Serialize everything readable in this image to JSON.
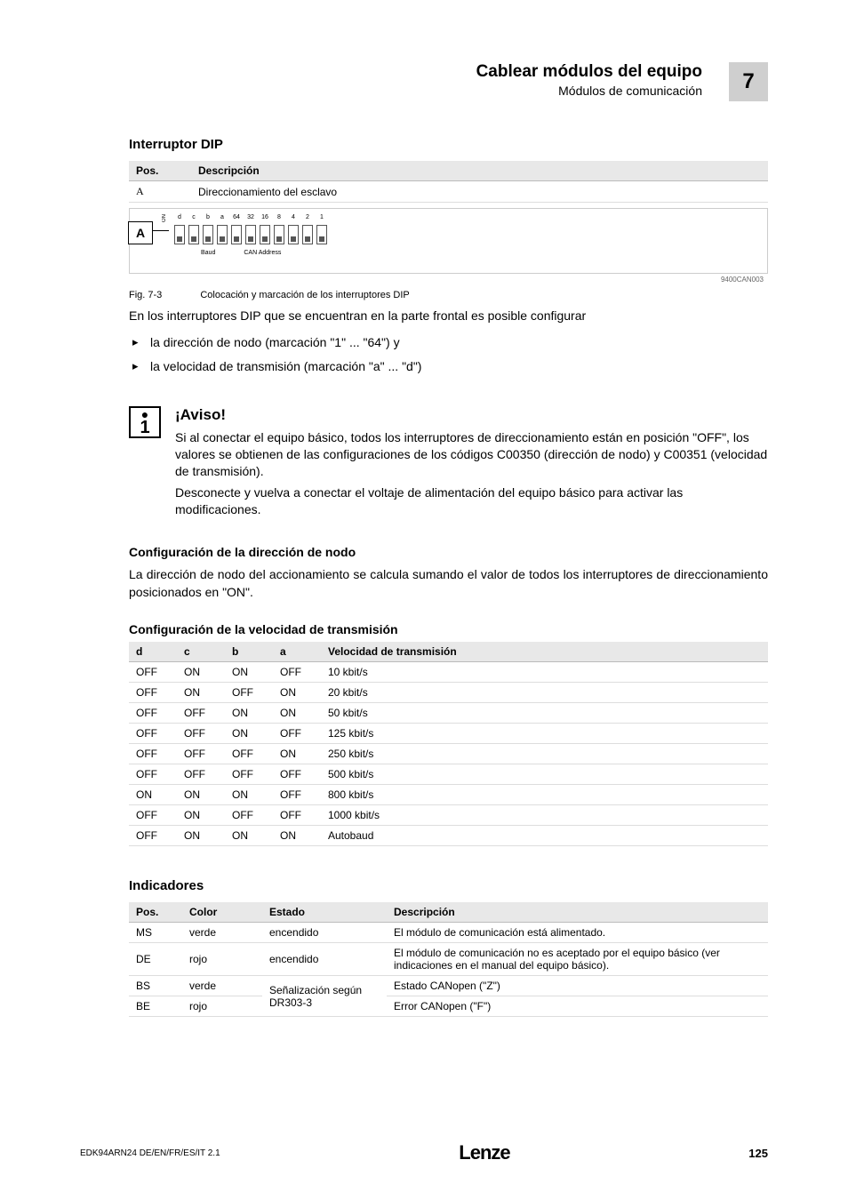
{
  "header": {
    "title": "Cablear módulos del equipo",
    "subtitle": "Módulos de comunicación",
    "section_number": "7"
  },
  "dip_section_title": "Interruptor DIP",
  "pos_table": {
    "head_pos": "Pos.",
    "head_desc": "Descripción",
    "pos_a": "A",
    "desc_a": "Direccionamiento del esclavo"
  },
  "dip_diagram": {
    "letter": "A",
    "on": "ON",
    "labels": [
      "d",
      "c",
      "b",
      "a",
      "64",
      "32",
      "16",
      "8",
      "4",
      "2",
      "1"
    ],
    "baud_label": "Baud",
    "addr_label": "CAN Address",
    "code": "9400CAN003"
  },
  "fig": {
    "no": "Fig. 7-3",
    "text": "Colocación y marcación de los interruptores DIP"
  },
  "intro_text": "En los interruptores DIP que se encuentran en la parte frontal es posible configurar",
  "bullets": {
    "b1": "la dirección de nodo (marcación \"1\" ... \"64\") y",
    "b2": "la velocidad de transmisión (marcación \"a\" ... \"d\")"
  },
  "aviso": {
    "title": "¡Aviso!",
    "p1": "Si al conectar el equipo básico, todos los interruptores de direccionamiento están en posición \"OFF\", los valores se obtienen de las configuraciones de los códigos C00350 (dirección de nodo) y C00351 (velocidad de transmisión).",
    "p2": "Desconecte y vuelva a conectar el voltaje de alimentación del equipo básico para activar las modificaciones."
  },
  "node_title": "Configuración de la dirección de nodo",
  "node_text": "La dirección de nodo del accionamiento se calcula sumando el valor de todos los interruptores de direccionamiento posicionados en \"ON\".",
  "baud_title": "Configuración de la velocidad de transmisión",
  "baud_table": {
    "headers": {
      "d": "d",
      "c": "c",
      "b": "b",
      "a": "a",
      "speed": "Velocidad de transmisión"
    },
    "rows": [
      {
        "d": "OFF",
        "c": "ON",
        "b": "ON",
        "a": "OFF",
        "speed": "10 kbit/s"
      },
      {
        "d": "OFF",
        "c": "ON",
        "b": "OFF",
        "a": "ON",
        "speed": "20 kbit/s"
      },
      {
        "d": "OFF",
        "c": "OFF",
        "b": "ON",
        "a": "ON",
        "speed": "50 kbit/s"
      },
      {
        "d": "OFF",
        "c": "OFF",
        "b": "ON",
        "a": "OFF",
        "speed": "125 kbit/s"
      },
      {
        "d": "OFF",
        "c": "OFF",
        "b": "OFF",
        "a": "ON",
        "speed": "250 kbit/s"
      },
      {
        "d": "OFF",
        "c": "OFF",
        "b": "OFF",
        "a": "OFF",
        "speed": "500 kbit/s"
      },
      {
        "d": "ON",
        "c": "ON",
        "b": "ON",
        "a": "OFF",
        "speed": "800 kbit/s"
      },
      {
        "d": "OFF",
        "c": "ON",
        "b": "OFF",
        "a": "OFF",
        "speed": "1000 kbit/s"
      },
      {
        "d": "OFF",
        "c": "ON",
        "b": "ON",
        "a": "ON",
        "speed": "Autobaud"
      }
    ]
  },
  "ind_title": "Indicadores",
  "ind_table": {
    "headers": {
      "pos": "Pos.",
      "color": "Color",
      "estado": "Estado",
      "desc": "Descripción"
    },
    "rows": [
      {
        "pos": "MS",
        "color": "verde",
        "estado": "encendido",
        "desc": "El módulo de comunicación está alimentado."
      },
      {
        "pos": "DE",
        "color": "rojo",
        "estado": "encendido",
        "desc": "El módulo de comunicación no es aceptado por el equipo básico (ver indicaciones en el manual del equipo básico)."
      },
      {
        "pos": "BS",
        "color": "verde",
        "estado": "Señalización según DR303-3",
        "desc": "Estado CANopen (\"Z\")"
      },
      {
        "pos": "BE",
        "color": "rojo",
        "estado": "",
        "desc": "Error CANopen (\"F\")"
      }
    ]
  },
  "footer": {
    "left": "EDK94ARN24   DE/EN/FR/ES/IT   2.1",
    "center": "Lenze",
    "right": "125"
  }
}
